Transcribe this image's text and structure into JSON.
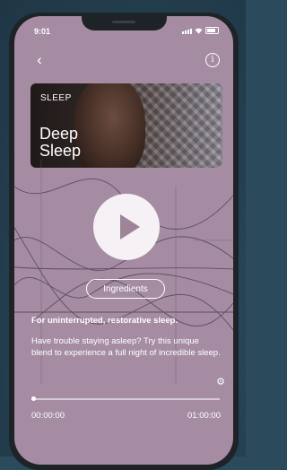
{
  "status": {
    "time": "9:01"
  },
  "nav": {
    "back_icon": "chevron-left-icon",
    "info_icon": "info-icon"
  },
  "hero": {
    "category": "SLEEP",
    "title_line1": "Deep",
    "title_line2": "Sleep"
  },
  "player": {
    "play_icon": "play-icon"
  },
  "ingredients_button": {
    "label": "Ingredients"
  },
  "content": {
    "subtitle": "For uninterrupted, restorative sleep.",
    "description": "Have trouble staying asleep? Try this unique blend to experience a full night of incredible sleep."
  },
  "progress": {
    "fraction": 0.0,
    "current": "00:00:00",
    "total": "01:00:00"
  },
  "colors": {
    "screen": "#a58ca3",
    "bezel": "#1e2327",
    "background": "#2b4a5c"
  }
}
